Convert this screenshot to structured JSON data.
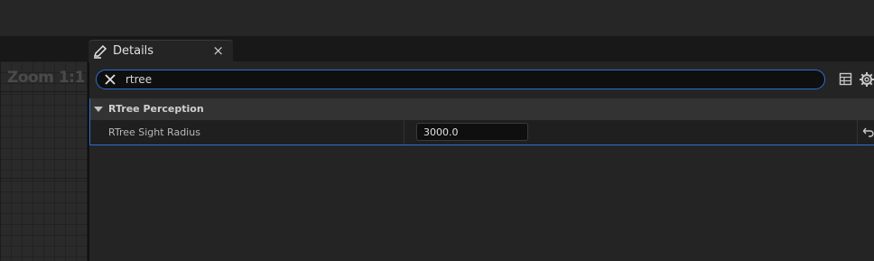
{
  "viewport": {
    "zoom_label": "Zoom 1:1"
  },
  "details_tab": {
    "title": "Details",
    "close_glyph": "×",
    "icon": "pencil-icon"
  },
  "search": {
    "value": "rtree",
    "clear_icon": "close-icon"
  },
  "toolbar": {
    "view_options_icon": "table-icon",
    "settings_icon": "gear-icon"
  },
  "category": {
    "label": "RTree Perception",
    "expanded": true
  },
  "properties": [
    {
      "name": "RTree Sight Radius",
      "value": "3000.0"
    }
  ],
  "colors": {
    "accent": "#2c6fd1",
    "panel_bg": "#242424",
    "category_bg": "#333333"
  }
}
